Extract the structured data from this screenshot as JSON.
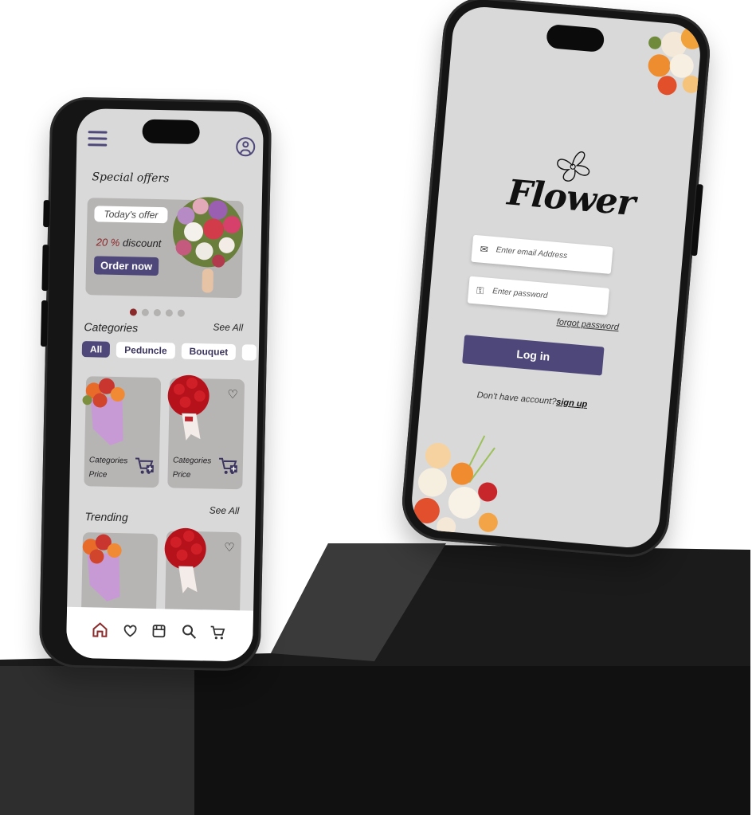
{
  "colors": {
    "accent": "#4e477a",
    "accent_red": "#8b2a2a",
    "screen_bg": "#d9d9d9",
    "card_bg": "#b7b4b4"
  },
  "home": {
    "special_offers_title": "Special offers",
    "offer": {
      "badge": "Today's offer",
      "discount_value": "20 %",
      "discount_label": "discount",
      "order_button": "Order now"
    },
    "carousel": {
      "count": 5,
      "active_index": 0
    },
    "categories": {
      "title": "Categories",
      "see_all": "See All",
      "chips": [
        "All",
        "Peduncle",
        "Bouquet"
      ]
    },
    "products": [
      {
        "name": "Categories",
        "price": "Price",
        "icon": "mixed-bouquet"
      },
      {
        "name": "Categories",
        "price": "Price",
        "icon": "red-roses"
      }
    ],
    "trending": {
      "title": "Trending",
      "see_all": "See All"
    },
    "bottom_nav": [
      "home-icon",
      "heart-icon",
      "store-icon",
      "search-icon",
      "cart-icon"
    ]
  },
  "login": {
    "logo_text": "Flower",
    "email_placeholder": "Enter email Address",
    "password_placeholder": "Enter password",
    "forgot_password": "forgot password",
    "login_button": "Log in",
    "no_account": "Don't have account?",
    "sign_up": "sign up"
  }
}
